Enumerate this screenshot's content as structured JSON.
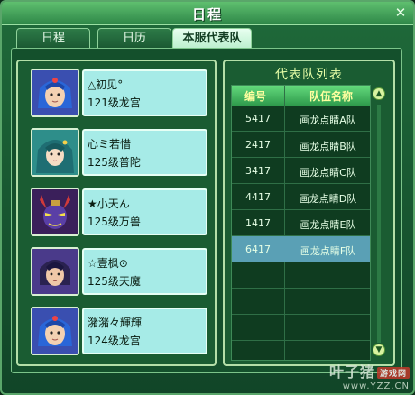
{
  "window": {
    "title": "日程",
    "close_icon": "close-icon"
  },
  "tabs": [
    {
      "label": "日程",
      "active": false
    },
    {
      "label": "日历",
      "active": false
    },
    {
      "label": "本服代表队",
      "active": true
    }
  ],
  "members": [
    {
      "name": "△初见°",
      "detail": "121级龙宫",
      "avatar": "character-portrait-blue-hair"
    },
    {
      "name": "心ミ若惜",
      "detail": "125级普陀",
      "avatar": "character-portrait-teal-hair"
    },
    {
      "name": "★小天ん",
      "detail": "125级万兽",
      "avatar": "character-portrait-demon"
    },
    {
      "name": "☆壹枫⊙",
      "detail": "125级天魔",
      "avatar": "character-portrait-dark-hair"
    },
    {
      "name": "潴潴々輝輝",
      "detail": "124级龙宫",
      "avatar": "character-portrait-blue-hair"
    }
  ],
  "team_list": {
    "title": "代表队列表",
    "headers": {
      "code": "编号",
      "name": "队伍名称"
    },
    "rows": [
      {
        "code": "5417",
        "name": "画龙点睛A队",
        "selected": false
      },
      {
        "code": "2417",
        "name": "画龙点睛B队",
        "selected": false
      },
      {
        "code": "3417",
        "name": "画龙点睛C队",
        "selected": false
      },
      {
        "code": "4417",
        "name": "画龙点睛D队",
        "selected": false
      },
      {
        "code": "1417",
        "name": "画龙点睛E队",
        "selected": false
      },
      {
        "code": "6417",
        "name": "画龙点睛F队",
        "selected": true
      }
    ]
  },
  "watermark": {
    "main": "叶子猪",
    "badge": "游戏网",
    "url": "www.YZZ.CN"
  },
  "colors": {
    "accent": "#63d97c",
    "selected_row": "#5aa0b5",
    "card_bg": "#a6ebe7"
  }
}
